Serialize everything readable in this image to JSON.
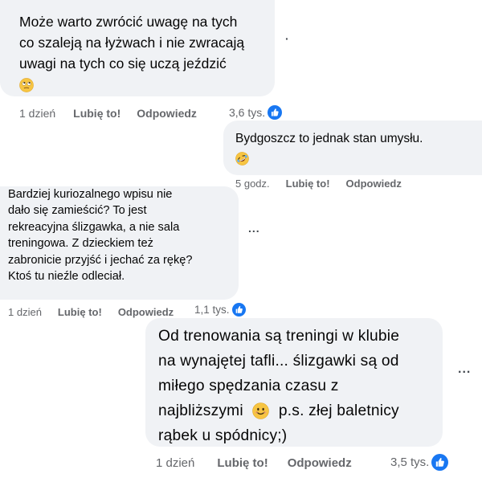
{
  "comments": [
    {
      "lines": [
        "Może warto zwrócić uwagę na tych",
        "co szaleją na łyżwach i nie zwracają",
        "uwagi na tych co się uczą jeździć"
      ],
      "emoji": "face-with-rolling-eyes",
      "time": "1 dzień",
      "like_label": "Lubię to!",
      "reply_label": "Odpowiedz",
      "reactions": "3,6 tys."
    },
    {
      "lines": [
        "Bydgoszcz to jednak stan umysłu."
      ],
      "emoji": "rolling-on-floor-laughing",
      "time": "5 godz.",
      "like_label": "Lubię to!",
      "reply_label": "Odpowiedz"
    },
    {
      "lines": [
        "Bardziej kuriozalnego wpisu nie",
        "dało się zamieścić? To jest",
        "rekreacyjna ślizgawka, a nie sala",
        "treningowa. Z dzieckiem też",
        "zabronicie przyjść i jechać za rękę?",
        "Ktoś tu nieźle odleciał."
      ],
      "time": "1 dzień",
      "like_label": "Lubię to!",
      "reply_label": "Odpowiedz",
      "reactions": "1,1 tys."
    },
    {
      "lines": [
        "Od trenowania są treningi w klubie",
        "na wynajętej tafli... ślizgawki są od",
        "miłego spędzania czasu z",
        "najbliższymi",
        "p.s. złej baletnicy",
        "rąbek u spódnicy;)"
      ],
      "emoji": "smiling-face",
      "time": "1 dzień",
      "like_label": "Lubię to!",
      "reply_label": "Odpowiedz",
      "reactions": "3,5 tys."
    }
  ],
  "icons": {
    "like": "like-thumb-icon",
    "more": "more-options-icon"
  },
  "colors": {
    "bubble": "#f0f2f5",
    "meta_text": "#65676b",
    "like_blue": "#1877f2",
    "emoji_yellow": "#f7c542"
  },
  "more_label": "..."
}
